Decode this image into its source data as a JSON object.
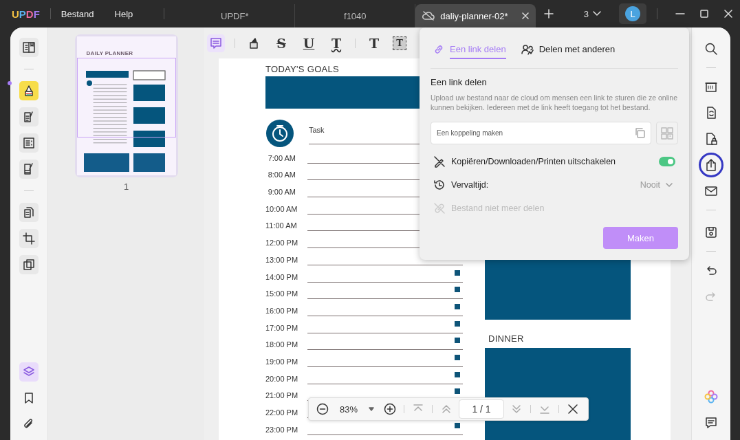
{
  "titlebar": {
    "logo": "UPDF",
    "menu": [
      "Bestand",
      "Help"
    ],
    "tabs": [
      {
        "label": "UPDF*",
        "selected": false
      },
      {
        "label": "f1040",
        "selected": false
      },
      {
        "label": "daliy-planner-02*",
        "selected": true
      }
    ],
    "tab_count": "3",
    "avatar": "L"
  },
  "left_toolbar": [
    {
      "selected": false
    },
    {
      "selected": true
    },
    {
      "selected": false
    },
    {
      "selected": false
    },
    {
      "selected": false
    },
    {
      "selected": false
    },
    {
      "selected": false
    },
    {
      "selected": false
    }
  ],
  "left_bottom": [
    {
      "selected": true
    },
    {
      "selected": false
    },
    {
      "selected": false
    }
  ],
  "thumbnails": [
    {
      "title": "DAILY PLANNER",
      "page_number": "1",
      "selected": true
    }
  ],
  "annotation_tools": [
    {
      "kind": "comment",
      "selected": true
    },
    {
      "kind": "highlighter",
      "selected": false
    },
    {
      "kind": "strikethrough",
      "glyph": "S",
      "selected": false
    },
    {
      "kind": "underline",
      "glyph": "U",
      "selected": false
    },
    {
      "kind": "squiggly",
      "glyph": "T",
      "selected": false
    },
    {
      "kind": "text",
      "glyph": "T",
      "selected": false
    },
    {
      "kind": "textbox",
      "glyph": "T",
      "selected": false
    }
  ],
  "document": {
    "goals_heading": "TODAY'S GOALS",
    "task_header": "Task",
    "times": [
      "7:00 AM",
      "8:00 AM",
      "9:00 AM",
      "10:00 AM",
      "11:00 AM",
      "12:00 PM",
      "13:00 PM",
      "14:00 PM",
      "15:00 PM",
      "16:00 PM",
      "17:00 PM",
      "18:00 PM",
      "19:00 PM",
      "20:00 PM",
      "21:00 PM",
      "22:00 PM",
      "23:00 PM"
    ],
    "dinner_heading": "DINNER"
  },
  "zoom_bar": {
    "zoom": "83%",
    "page": "1 / 1"
  },
  "right_toolbar": [
    {
      "selected": false,
      "disabled": false
    },
    {
      "selected": false,
      "disabled": false
    },
    {
      "selected": false,
      "disabled": false
    },
    {
      "selected": false,
      "disabled": false
    },
    {
      "selected": true,
      "disabled": false
    },
    {
      "selected": false,
      "disabled": false
    },
    {
      "selected": false,
      "disabled": false
    },
    {
      "selected": false,
      "disabled": false
    },
    {
      "selected": false,
      "disabled": true
    }
  ],
  "share_popup": {
    "tabs": [
      {
        "label": "Een link delen",
        "selected": true
      },
      {
        "label": "Delen met anderen",
        "selected": false
      }
    ],
    "heading": "Een link delen",
    "description": "Upload uw bestand naar de cloud om mensen een link te sturen die ze online kunnen bekijken. Iedereen met de link heeft toegang tot het bestand.",
    "link_field": {
      "placeholder": "Een koppeling maken"
    },
    "options": [
      {
        "kind": "toggle",
        "label": "Kopiëren/Downloaden/Printen uitschakelen",
        "on": true
      },
      {
        "kind": "select",
        "label": "Vervaltijd:",
        "value": "Nooit"
      },
      {
        "kind": "action",
        "label": "Bestand niet meer delen",
        "disabled": true
      }
    ],
    "button": "Maken"
  }
}
